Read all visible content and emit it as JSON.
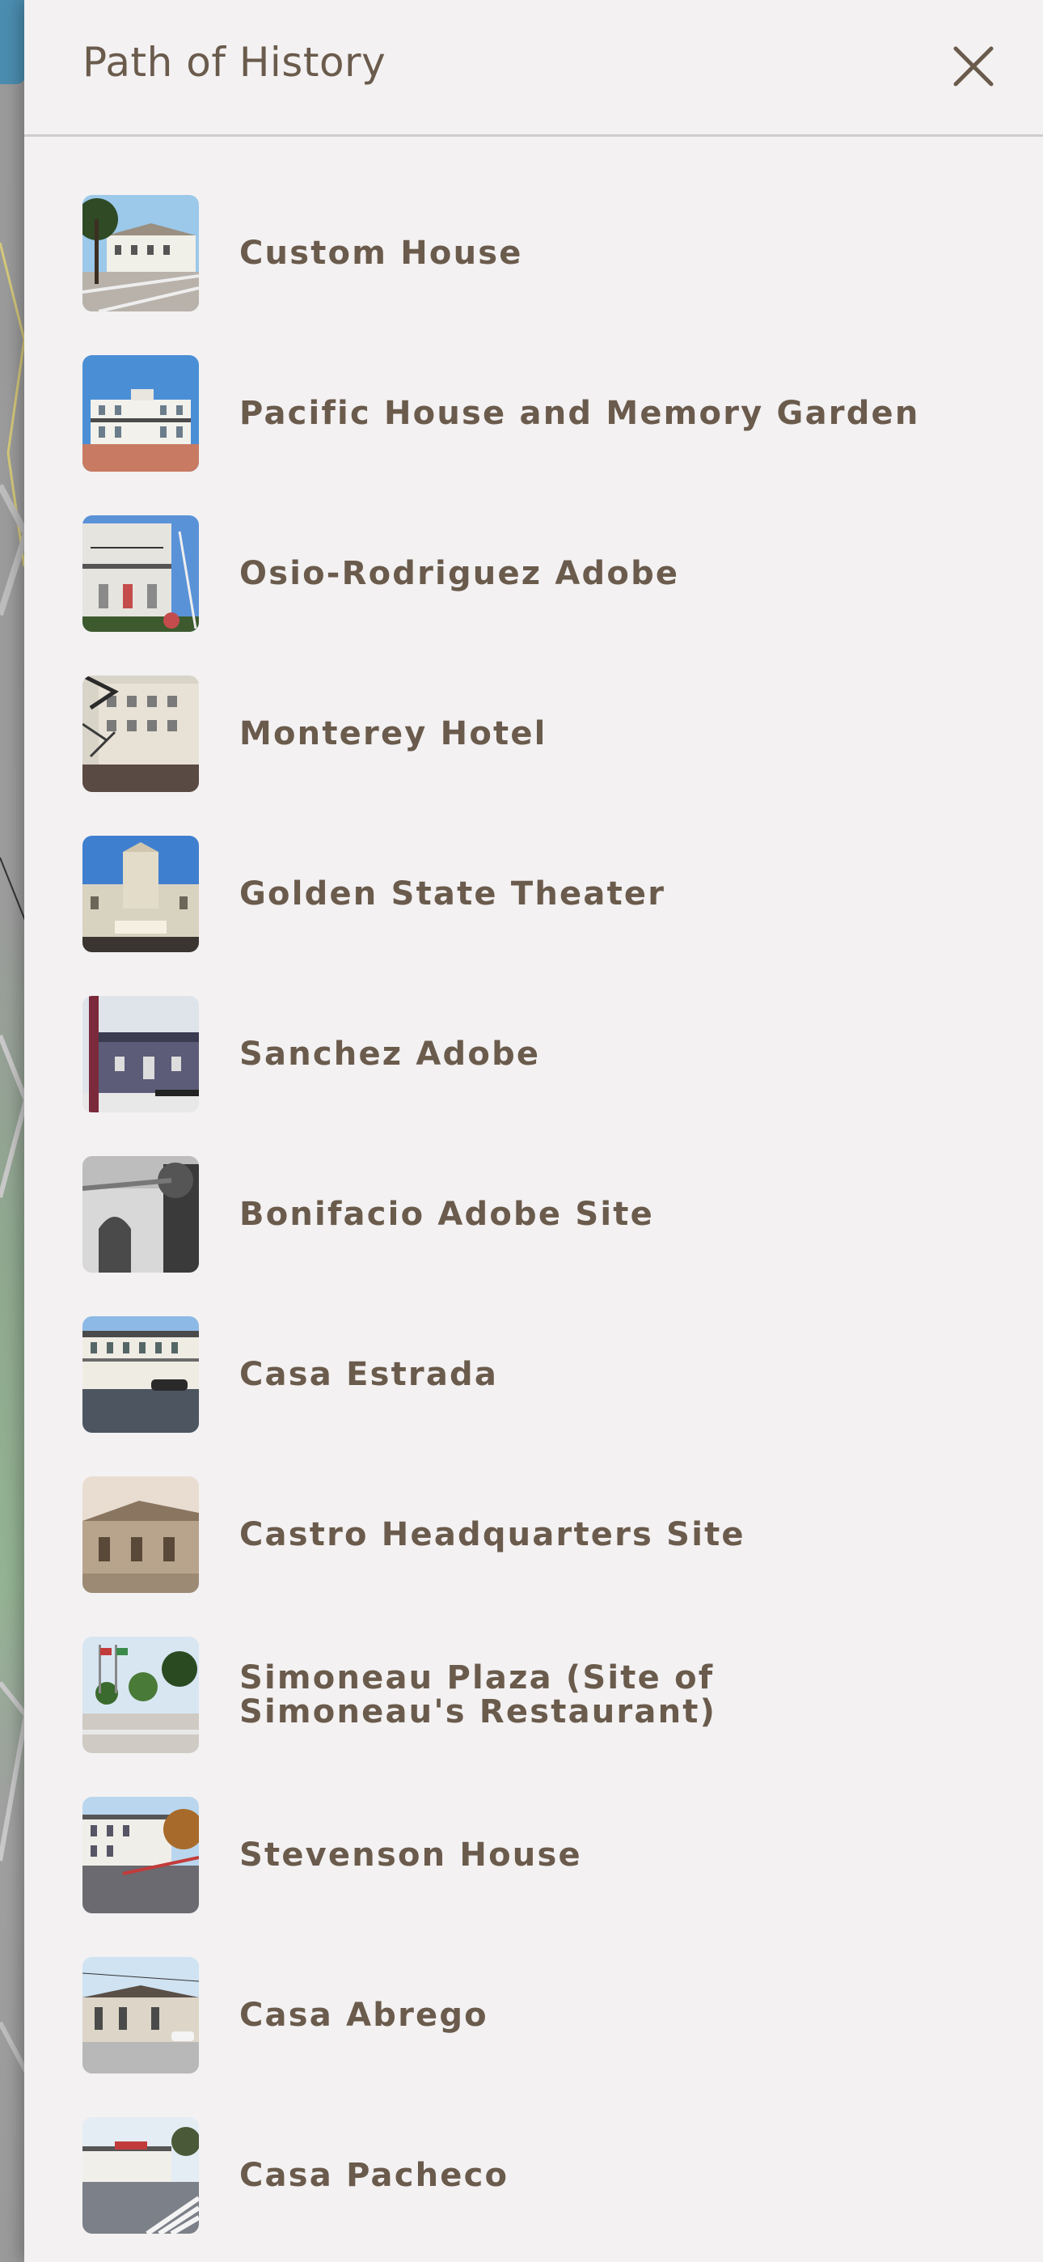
{
  "drawer": {
    "title": "Path of History",
    "close_icon": "close-icon"
  },
  "colors": {
    "drawer_bg": "#f3f1f2",
    "text": "#6a5b4c",
    "divider": "#cfcdce"
  },
  "sites": [
    {
      "label": "Custom House",
      "thumb": "custom-house-photo"
    },
    {
      "label": "Pacific House and Memory Garden",
      "thumb": "pacific-house-photo"
    },
    {
      "label": "Osio-Rodriguez Adobe",
      "thumb": "osio-rodriguez-photo"
    },
    {
      "label": "Monterey Hotel",
      "thumb": "monterey-hotel-photo"
    },
    {
      "label": "Golden State Theater",
      "thumb": "golden-state-theater-photo"
    },
    {
      "label": "Sanchez Adobe",
      "thumb": "sanchez-adobe-photo"
    },
    {
      "label": "Bonifacio Adobe Site",
      "thumb": "bonifacio-adobe-photo"
    },
    {
      "label": "Casa Estrada",
      "thumb": "casa-estrada-photo"
    },
    {
      "label": "Castro Headquarters Site",
      "thumb": "castro-headquarters-photo"
    },
    {
      "label": "Simoneau Plaza (Site of Simoneau's Restaurant)",
      "thumb": "simoneau-plaza-photo"
    },
    {
      "label": "Stevenson House",
      "thumb": "stevenson-house-photo"
    },
    {
      "label": "Casa Abrego",
      "thumb": "casa-abrego-photo"
    },
    {
      "label": "Casa Pacheco",
      "thumb": "casa-pacheco-photo"
    }
  ]
}
